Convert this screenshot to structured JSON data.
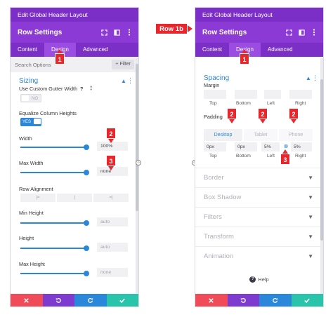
{
  "left": {
    "breadcrumb": "Edit Global Header Layout",
    "title": "Row Settings",
    "tabs": [
      {
        "label": "Content",
        "active": false
      },
      {
        "label": "Design",
        "active": true
      },
      {
        "label": "Advanced",
        "active": false
      }
    ],
    "search_placeholder": "Search Options",
    "filter_label": "+ Filter",
    "section_title": "Sizing",
    "fields": {
      "gutter_label": "Use Custom Gutter Width",
      "gutter_help": "?",
      "gutter_toggle": "NO",
      "equalize_label": "Equalize Column Heights",
      "equalize_toggle": "YES",
      "width_label": "Width",
      "width_value": "100%",
      "width_level": 1.0,
      "max_width_label": "Max Width",
      "max_width_value": "none",
      "max_width_level": 1.0,
      "row_alignment_label": "Row Alignment",
      "align_left": "|=",
      "align_center": "|",
      "align_right": "=|",
      "min_height_label": "Min Height",
      "min_height_value": "auto",
      "height_label": "Height",
      "height_value": "auto",
      "max_height_label": "Max Height",
      "max_height_value": "none"
    }
  },
  "right": {
    "breadcrumb": "Edit Global Header Layout",
    "title": "Row Settings",
    "tabs": [
      {
        "label": "Content",
        "active": false
      },
      {
        "label": "Design",
        "active": true
      },
      {
        "label": "Advanced",
        "active": false
      }
    ],
    "section_title": "Spacing",
    "margin_label": "Margin",
    "margin_sides": [
      "Top",
      "Bottom",
      "Left",
      "Right"
    ],
    "padding_label": "Padding",
    "device_tabs": [
      "Desktop",
      "Tablet",
      "Phone"
    ],
    "padding_values": [
      "0px",
      "0px",
      "5%",
      "5%"
    ],
    "padding_sides": [
      "Top",
      "Bottom",
      "Left",
      "Right"
    ],
    "collapsed_sections": [
      "Border",
      "Box Shadow",
      "Filters",
      "Transform",
      "Animation"
    ],
    "help_label": "Help"
  },
  "annotations": {
    "row_label": "Row 1b",
    "left_badges": [
      "1",
      "2",
      "3"
    ],
    "right_badges": [
      "1",
      "2",
      "2",
      "2",
      "3"
    ]
  },
  "icons": {
    "header": [
      "expand-icon",
      "columns-icon",
      "more-icon"
    ],
    "footer": [
      "close-icon",
      "undo-icon",
      "redo-icon",
      "check-icon"
    ]
  },
  "colors": {
    "purple_dark": "#7b2fc6",
    "purple_header": "#8b3ad6",
    "blue_accent": "#2b87da",
    "red_badge": "#e8262c",
    "cancel_red": "#ef4b59",
    "save_teal": "#29c4a9"
  }
}
